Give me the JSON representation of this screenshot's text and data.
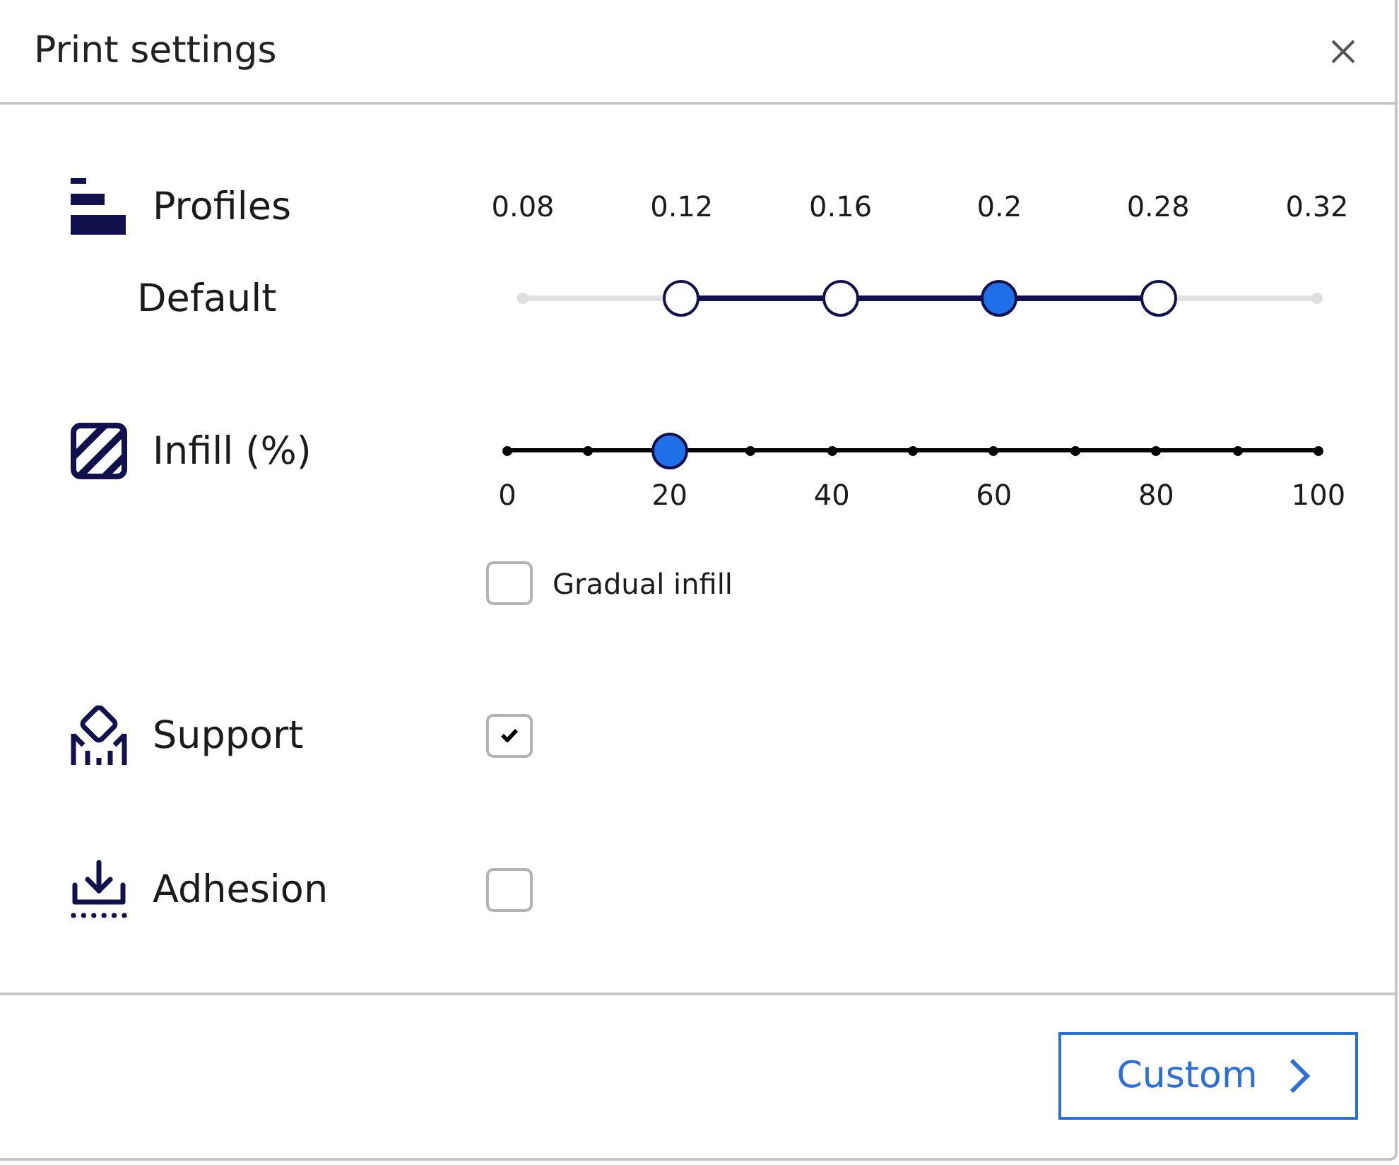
{
  "window": {
    "title": "Print settings"
  },
  "settings": [
    {
      "kind": "profiles",
      "label": "Profiles",
      "profile": "Default",
      "layer_heights": [
        {
          "label": "0.08",
          "available": false,
          "selected": false
        },
        {
          "label": "0.12",
          "available": true,
          "selected": false
        },
        {
          "label": "0.16",
          "available": true,
          "selected": false
        },
        {
          "label": "0.2",
          "available": true,
          "selected": true
        },
        {
          "label": "0.28",
          "available": true,
          "selected": false
        },
        {
          "label": "0.32",
          "available": false,
          "selected": false
        }
      ]
    },
    {
      "kind": "infill",
      "label": "Infill (%)",
      "level": 0.2,
      "scale": [
        "0",
        "20",
        "40",
        "60",
        "80",
        "100"
      ],
      "gradual": {
        "label": "Gradual infill",
        "checked": false
      }
    },
    {
      "kind": "checkbox",
      "label": "Support",
      "checked": true
    },
    {
      "kind": "checkbox",
      "label": "Adhesion",
      "checked": false
    }
  ],
  "footer": {
    "button": "Custom"
  }
}
